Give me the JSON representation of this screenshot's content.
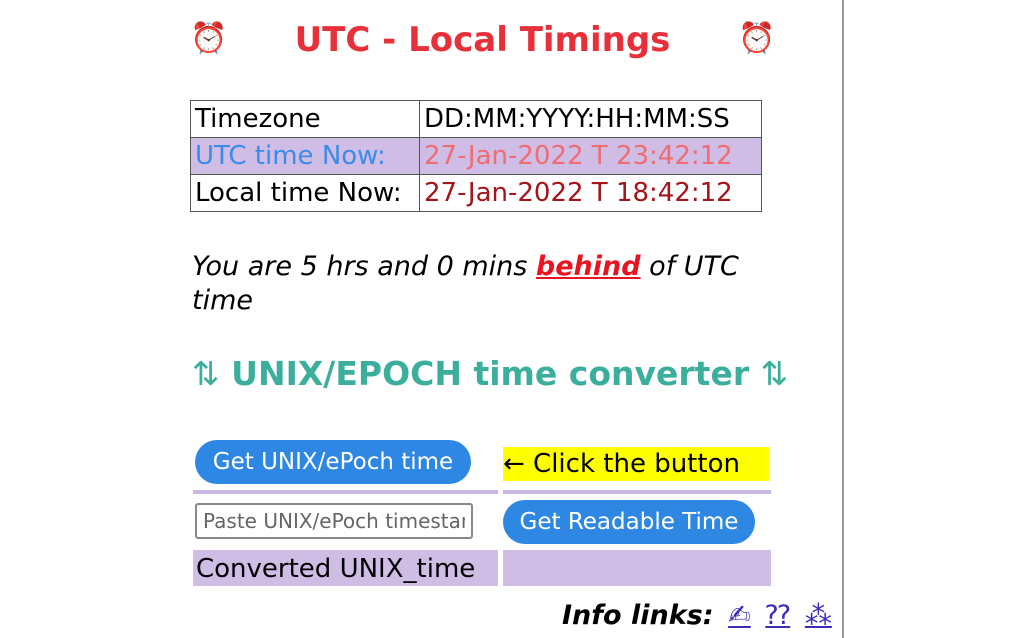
{
  "header": {
    "title": "UTC - Local Timings",
    "left_icon": "⏰",
    "right_icon": "⏰"
  },
  "table": {
    "headers": [
      "Timezone",
      "DD:MM:YYYY:HH:MM:SS"
    ],
    "utc": {
      "label": "UTC time Now:",
      "value": "27-Jan-2022 T 23:42:12"
    },
    "local": {
      "label": "Local time Now:",
      "value": "27-Jan-2022 T 18:42:12"
    }
  },
  "difference": {
    "prefix": "You are 5 hrs and 0 mins ",
    "direction": "behind",
    "suffix": " of UTC time"
  },
  "converter": {
    "arrow_left": "⇅",
    "title": "UNIX/EPOCH time converter",
    "arrow_right": "⇅",
    "get_unix_label": "Get UNIX/ePoch time",
    "hint": "← Click the button",
    "input_placeholder": "Paste UNIX/ePoch timestamp",
    "input_value": "",
    "get_readable_label": "Get Readable Time",
    "converted_label": "Converted UNIX_time",
    "converted_value": ""
  },
  "info": {
    "label": "Info links:",
    "link1": "✍",
    "link2": "⁇",
    "link3": "⁂"
  },
  "colors": {
    "title": "#e8303a",
    "accent_teal": "#3cae9c",
    "button_blue": "#2f87e4",
    "lavender": "#cfbde6",
    "hint_yellow": "#ffff00"
  }
}
